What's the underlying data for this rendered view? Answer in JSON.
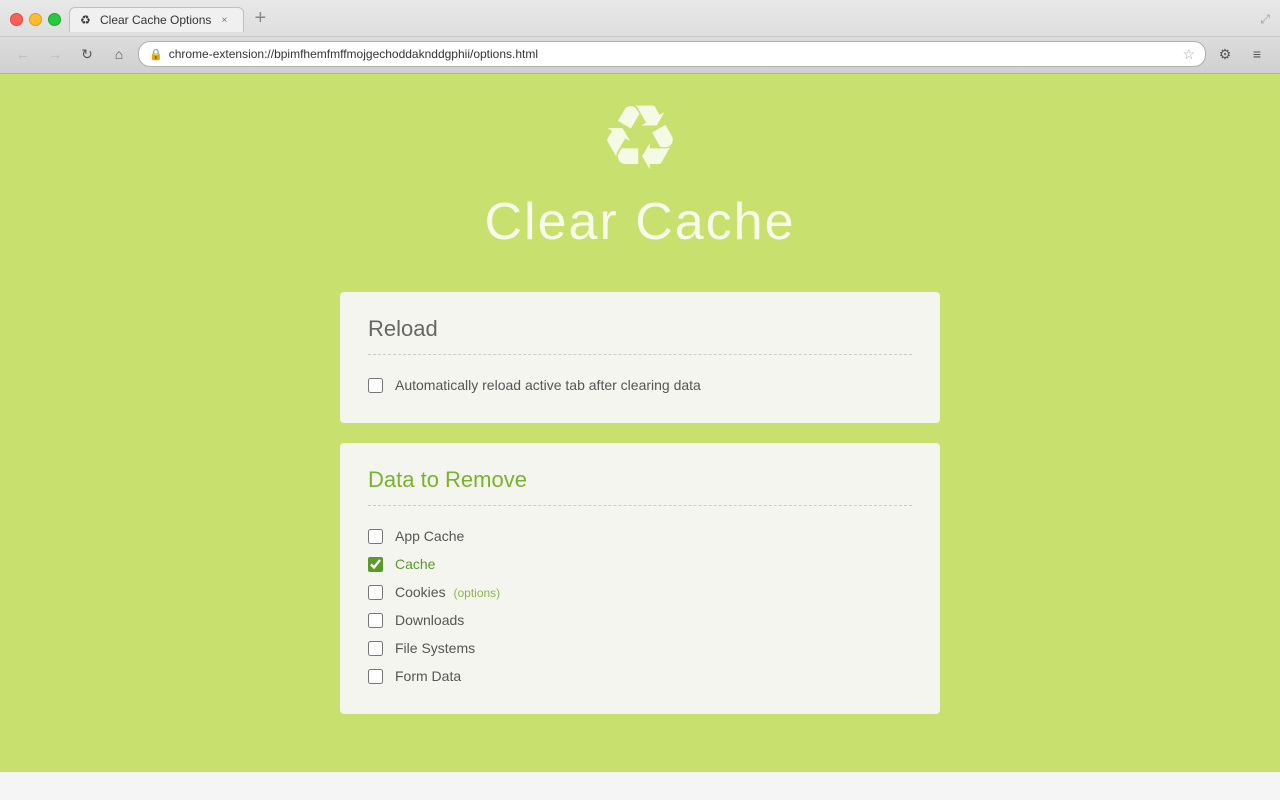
{
  "browser": {
    "tab_title": "Clear Cache Options",
    "tab_favicon": "♻",
    "url": "chrome-extension://bpimfhemfmffmojgechoddaknddgphii/options.html",
    "back_label": "←",
    "forward_label": "→",
    "reload_label": "↻",
    "home_label": "⌂",
    "star_label": "☆",
    "extensions_label": "⚙",
    "menu_label": "≡",
    "tab_close_label": "×"
  },
  "page": {
    "app_title": "Clear Cache",
    "colors": {
      "bg": "#c8e06e",
      "card_bg": "#f5f5ef",
      "title_gray": "#666",
      "title_green": "#7ab32e"
    }
  },
  "reload_section": {
    "title": "Reload",
    "checkbox_label": "Automatically reload active tab after clearing data",
    "checked": false
  },
  "data_section": {
    "title": "Data to Remove",
    "items": [
      {
        "label": "App Cache",
        "checked": false,
        "green": false,
        "options": false
      },
      {
        "label": "Cache",
        "checked": true,
        "green": true,
        "options": false
      },
      {
        "label": "Cookies",
        "checked": false,
        "green": false,
        "options": true,
        "options_label": "(options)"
      },
      {
        "label": "Downloads",
        "checked": false,
        "green": false,
        "options": false
      },
      {
        "label": "File Systems",
        "checked": false,
        "green": false,
        "options": false
      },
      {
        "label": "Form Data",
        "checked": false,
        "green": false,
        "options": false
      }
    ]
  }
}
